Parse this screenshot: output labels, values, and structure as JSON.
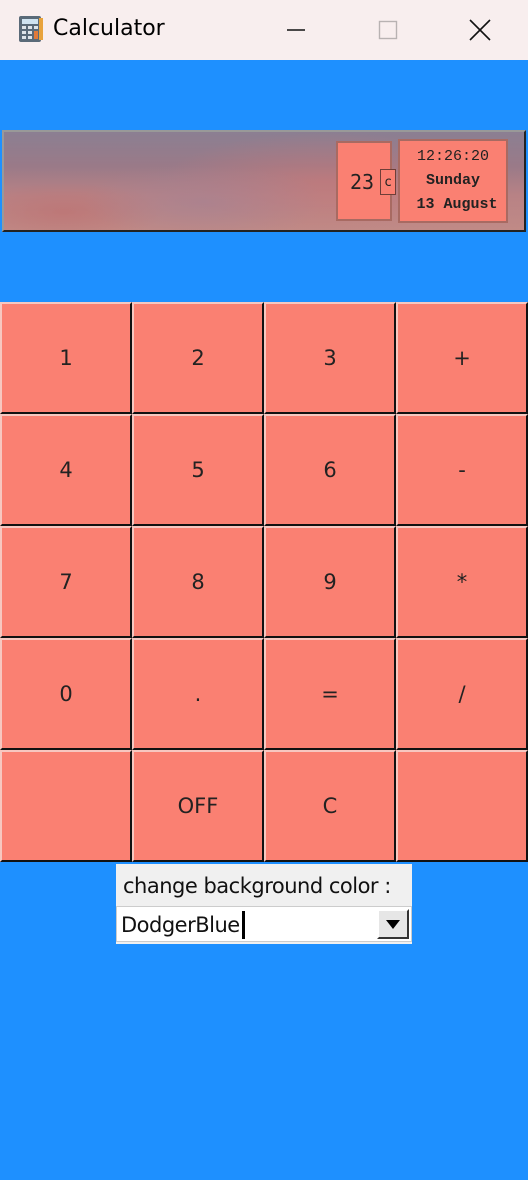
{
  "window": {
    "title": "Calculator",
    "app_icon": "calculator-icon",
    "controls": [
      "minimize-icon",
      "maximize-icon",
      "close-icon"
    ]
  },
  "banner": {
    "temperature": "23",
    "temperature_unit": "c",
    "time": "12:26:20",
    "day": "Sunday",
    "date": "13 August"
  },
  "keypad": {
    "keys": [
      "1",
      "2",
      "3",
      "+",
      "4",
      "5",
      "6",
      "-",
      "7",
      "8",
      "9",
      "*",
      "0",
      ".",
      "=",
      "/",
      "",
      "OFF",
      "C",
      ""
    ]
  },
  "background_selector": {
    "label": "change background color :",
    "selected": "DodgerBlue"
  },
  "colors": {
    "background": "#1e90ff",
    "key_face": "#fa8072",
    "title_bar": "#f8eeee"
  }
}
